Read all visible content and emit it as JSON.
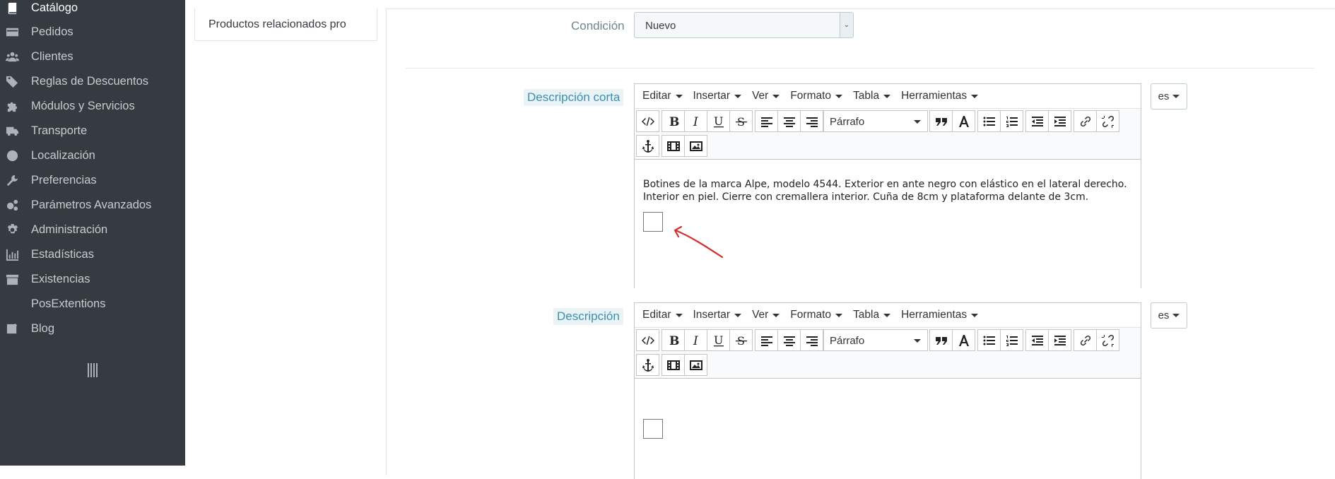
{
  "sidebar": {
    "items": [
      {
        "label": "Catálogo",
        "icon": "book-icon",
        "active": true
      },
      {
        "label": "Pedidos",
        "icon": "credit-card-icon"
      },
      {
        "label": "Clientes",
        "icon": "users-icon"
      },
      {
        "label": "Reglas de Descuentos",
        "icon": "tags-icon"
      },
      {
        "label": "Módulos y Servicios",
        "icon": "puzzle-icon"
      },
      {
        "label": "Transporte",
        "icon": "truck-icon"
      },
      {
        "label": "Localización",
        "icon": "globe-icon"
      },
      {
        "label": "Preferencias",
        "icon": "wrench-icon"
      },
      {
        "label": "Parámetros Avanzados",
        "icon": "cogs-icon"
      },
      {
        "label": "Administración",
        "icon": "gear-icon"
      },
      {
        "label": "Estadísticas",
        "icon": "bar-chart-icon"
      },
      {
        "label": "Existencias",
        "icon": "archive-icon"
      },
      {
        "label": "PosExtentions",
        "icon": ""
      },
      {
        "label": "Blog",
        "icon": "edit-icon"
      }
    ],
    "toggle_icon": "collapse-bars-icon"
  },
  "subtabs": {
    "current": "Productos relacionados pro"
  },
  "form": {
    "condition": {
      "label": "Condición",
      "value": "Nuevo"
    },
    "short_description": {
      "label": "Descripción corta",
      "language": "es",
      "text": "Botines de la marca Alpe, modelo 4544. Exterior en ante negro con elástico en el lateral derecho. Interior en piel. Cierre con cremallera interior. Cuña de 8cm y plataforma delante de 3cm."
    },
    "description": {
      "label": "Descripción",
      "language": "es",
      "text": ""
    }
  },
  "editor": {
    "menu": [
      "Editar",
      "Insertar",
      "Ver",
      "Formato",
      "Tabla",
      "Herramientas"
    ],
    "block_format": "Párrafo",
    "tool_icons": [
      "source-code-icon",
      "bold-icon",
      "italic-icon",
      "underline-icon",
      "strikethrough-icon",
      "align-left-icon",
      "align-center-icon",
      "align-right-icon",
      "blockquote-icon",
      "text-color-icon",
      "bullet-list-icon",
      "numbered-list-icon",
      "outdent-icon",
      "indent-icon",
      "link-icon",
      "unlink-icon",
      "anchor-icon",
      "media-icon",
      "image-icon"
    ]
  },
  "annotation": {
    "color": "#d32f2f"
  }
}
